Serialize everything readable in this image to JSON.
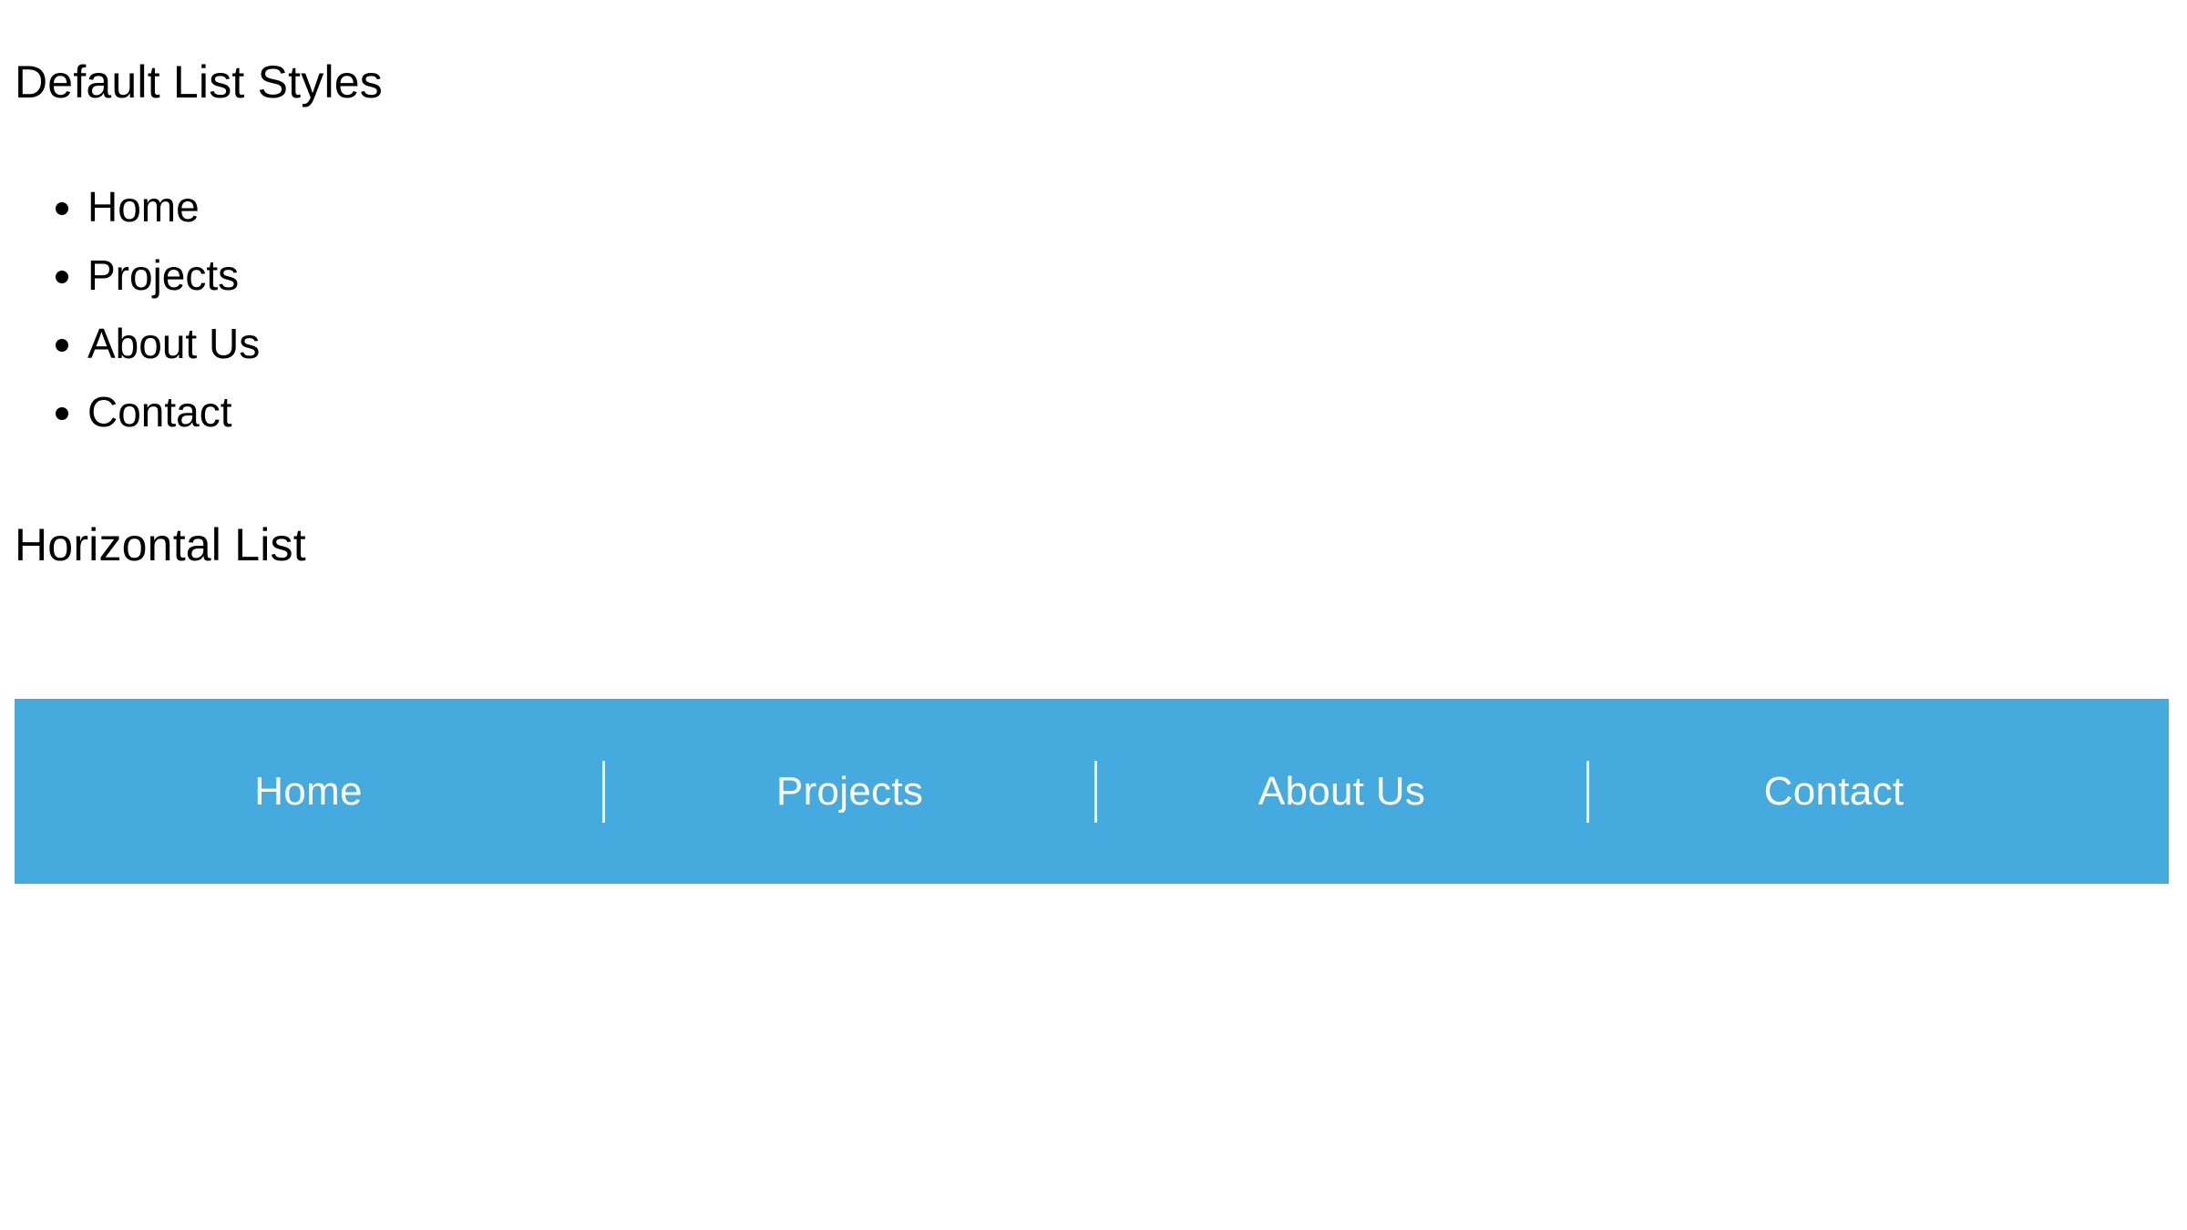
{
  "page": {
    "background_color": "#ffffff",
    "text_color": "#000000"
  },
  "sections": {
    "default_list": {
      "heading": "Default List Styles",
      "marker": "disc",
      "items": [
        {
          "label": "Home"
        },
        {
          "label": "Projects"
        },
        {
          "label": "About Us"
        },
        {
          "label": "Contact"
        }
      ]
    },
    "horizontal_list": {
      "heading": "Horizontal List",
      "nav": {
        "background_color": "#45abdf",
        "link_color": "#ffffff",
        "divider_color": "#ffffff",
        "items": [
          {
            "label": "Home"
          },
          {
            "label": "Projects"
          },
          {
            "label": "About Us"
          },
          {
            "label": "Contact"
          }
        ]
      }
    }
  }
}
